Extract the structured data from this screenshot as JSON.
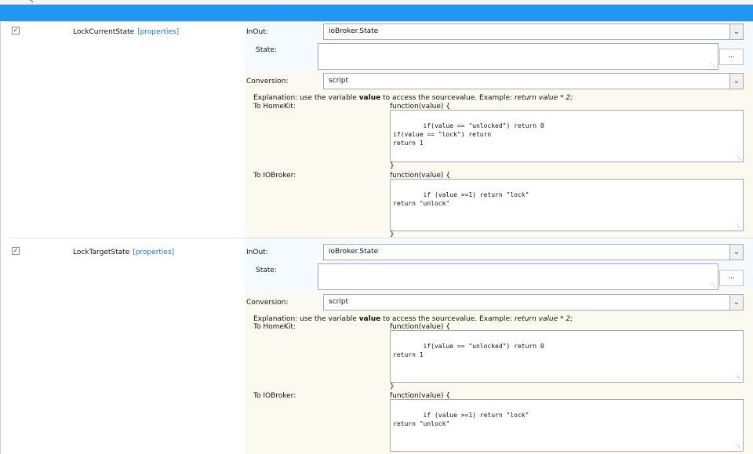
{
  "rows": [
    {
      "name": "LockCurrentState",
      "link": "[properties]",
      "checked": true,
      "inout_label": "InOut:",
      "inout_value": "ioBroker.State",
      "state_label": "State:",
      "state_value": "",
      "dots_label": "...",
      "conversion_label": "Conversion:",
      "conversion_value": "script",
      "explanation_prefix": "Explanation: use the variable ",
      "explanation_bold": "value",
      "explanation_middle": " to access the sourcevalue. Example: ",
      "explanation_example": "return value * 2;",
      "to_homekit_label": "To HomeKit:",
      "homekit_fn_open": "function(value) {",
      "homekit_code": "if(value == \"unlocked\") return 0\nif(value == \"lock\") return\nreturn 1",
      "homekit_fn_close": "}",
      "to_iobroker_label": "To IOBroker:",
      "iobroker_fn_open": "function(value) {",
      "iobroker_code": "if (value >=1) return \"lock\"\nreturn \"unlock\"",
      "iobroker_fn_close": "}"
    },
    {
      "name": "LockTargetState",
      "link": "[properties]",
      "checked": true,
      "inout_label": "InOut:",
      "inout_value": "ioBroker.State",
      "state_label": "State:",
      "state_value": "",
      "dots_label": "...",
      "conversion_label": "Conversion:",
      "conversion_value": "script",
      "explanation_prefix": "Explanation: use the variable ",
      "explanation_bold": "value",
      "explanation_middle": " to access the sourcevalue. Example: ",
      "explanation_example": "return value * 2;",
      "to_homekit_label": "To HomeKit:",
      "homekit_fn_open": "function(value) {",
      "homekit_code": "if(value == \"unlocked\") return 0\nreturn 1",
      "homekit_fn_close": "}",
      "to_iobroker_label": "To IOBroker:",
      "iobroker_fn_open": "function(value) {",
      "iobroker_code": "if (value >=1) return \"lock\"\nreturn \"unlock\"",
      "iobroker_fn_close": "}"
    }
  ],
  "icons": {
    "checkbox": "checkmark-icon",
    "select_arrow": "chevron-down-icon",
    "resize": "resize-grip-icon"
  },
  "colors": {
    "header_bar": "#2196f3",
    "link": "#1976d2",
    "inout_bg": "#f5faff",
    "conversion_bg": "#fafaf0"
  }
}
